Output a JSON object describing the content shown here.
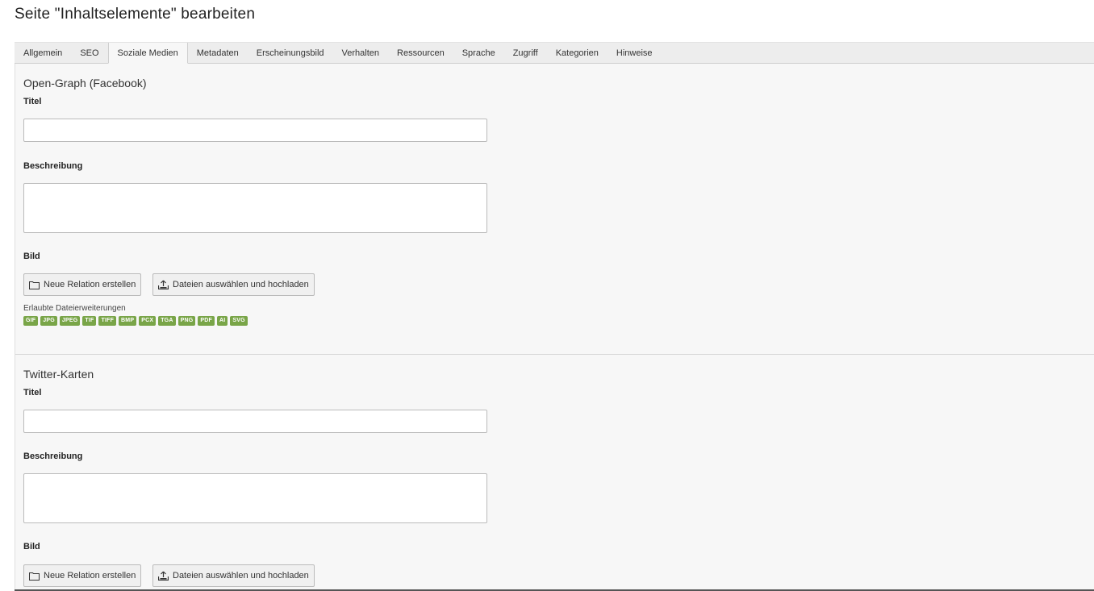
{
  "page": {
    "title": "Seite \"Inhaltselemente\" bearbeiten"
  },
  "tabs": [
    {
      "label": "Allgemein",
      "active": false
    },
    {
      "label": "SEO",
      "active": false
    },
    {
      "label": "Soziale Medien",
      "active": true
    },
    {
      "label": "Metadaten",
      "active": false
    },
    {
      "label": "Erscheinungsbild",
      "active": false
    },
    {
      "label": "Verhalten",
      "active": false
    },
    {
      "label": "Ressourcen",
      "active": false
    },
    {
      "label": "Sprache",
      "active": false
    },
    {
      "label": "Zugriff",
      "active": false
    },
    {
      "label": "Kategorien",
      "active": false
    },
    {
      "label": "Hinweise",
      "active": false
    }
  ],
  "og": {
    "section_title": "Open-Graph (Facebook)",
    "title_label": "Titel",
    "title_value": "",
    "description_label": "Beschreibung",
    "description_value": "",
    "image_label": "Bild",
    "new_relation_label": "Neue Relation erstellen",
    "upload_label": "Dateien auswählen und hochladen",
    "allowed_ext_label": "Erlaubte Dateierweiterungen",
    "extensions": [
      "GIF",
      "JPG",
      "JPEG",
      "TIF",
      "TIFF",
      "BMP",
      "PCX",
      "TGA",
      "PNG",
      "PDF",
      "AI",
      "SVG"
    ]
  },
  "twitter": {
    "section_title": "Twitter-Karten",
    "title_label": "Titel",
    "title_value": "",
    "description_label": "Beschreibung",
    "description_value": "",
    "image_label": "Bild",
    "new_relation_label": "Neue Relation erstellen",
    "upload_label": "Dateien auswählen und hochladen"
  },
  "icons": {
    "folder": "folder-icon",
    "upload": "upload-icon"
  },
  "colors": {
    "badge": "#79a548",
    "panel": "#f7f7f7",
    "tabbar": "#ededed"
  }
}
